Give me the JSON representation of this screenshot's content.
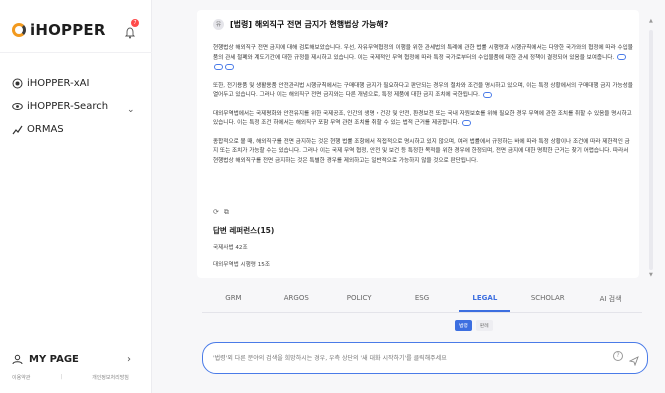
{
  "app": {
    "title": "iHOPPER"
  },
  "header": {
    "notification_count": "7"
  },
  "sidebar": {
    "items": [
      {
        "label": "iHOPPER-xAI"
      },
      {
        "label": "iHOPPER-Search"
      },
      {
        "label": "ORMAS"
      }
    ],
    "mypage_label": "MY PAGE",
    "footer": {
      "left": "이용약관",
      "right": "개인정보처리방침"
    }
  },
  "conversation": {
    "question_avatar": "유",
    "question": "[법령] 해외직구 전면 금지가 현행법상 가능해?",
    "answer": [
      "현행법상 해외직구 전면 금지에 대해 검토해보았습니다. 우선, 자유무역협정의 이행을 위한 관세법의 특례에 관한 법률 시행령과 시행규칙에서는 다양한 국가와의 협정에 따라 수입물품의 관세 철폐와 계도기간에 대한 규정을 제시하고 있습니다. 이는 국제적인 무역 협정에 따라 특정 국가로부터의 수입물품에 대한 관세 정책이 결정되어 있음을 보여줍니다.",
      "또한, 전기용품 및 생활용품 안전관리법 시행규칙에서는 구매대행 금지가 필요하다고 판단되는 경우의 절차와 조건을 명시하고 있으며, 이는 특정 상황에서의 구매대행 금지 가능성을 열어두고 있습니다. 그러나 이는 해외직구 전면 금지와는 다른 개념으로, 특정 제품에 대한 금지 조치에 국한됩니다.",
      "대외무역법에서는 국제평화와 안전유지를 위한 국제공조, 인간의 생명・건강 및 안전, 환경보전 또는 국내 자원보호를 위해 필요한 경우 무역에 관한 조치를 취할 수 있음을 명시하고 있습니다. 이는 특정 조건 하에서는 해외직구 포함 무역 관련 조치를 취할 수 있는 법적 근거를 제공합니다.",
      "종합적으로 볼 때, 해외직구를 전면 금지하는 것은 현행 법률 조항에서 직접적으로 명시하고 있지 않으며, 여러 법률에서 규정하는 바에 따라 특정 상황이나 조건에 따라 제한적인 금지 또는 조치가 가능할 수는 있습니다. 그러나 이는 국제 무역 협정, 안전 및 보건 등 특정한 목적을 위한 경우에 한정되며, 전면 금지에 대한 명확한 근거는 찾기 어렵습니다. 따라서 현행법상 해외직구를 전면 금지하는 것은 특별한 경우를 제외하고는 일반적으로 가능하지 않을 것으로 판단됩니다."
    ],
    "refs_title": "답변 레퍼런스(15)",
    "refs": [
      "국제사법 42조",
      "대외무역법 시행령 15조"
    ]
  },
  "tabs": [
    {
      "label": "GRM"
    },
    {
      "label": "ARGOS"
    },
    {
      "label": "POLICY"
    },
    {
      "label": "ESG"
    },
    {
      "label": "LEGAL"
    },
    {
      "label": "SCHOLAR"
    },
    {
      "label": "AI 검색"
    }
  ],
  "active_tab": "LEGAL",
  "subtabs": [
    {
      "label": "법령"
    },
    {
      "label": "판례"
    }
  ],
  "search": {
    "placeholder": "'법령'외 다른 분야의 검색을 희망하시는 경우, 우측 상단의 '새 대화 시작하기'를 클릭해주세요"
  },
  "colors": {
    "accent": "#3d6fe0",
    "logo_orange": "#f29a1f",
    "badge": "#ff4b4b"
  }
}
